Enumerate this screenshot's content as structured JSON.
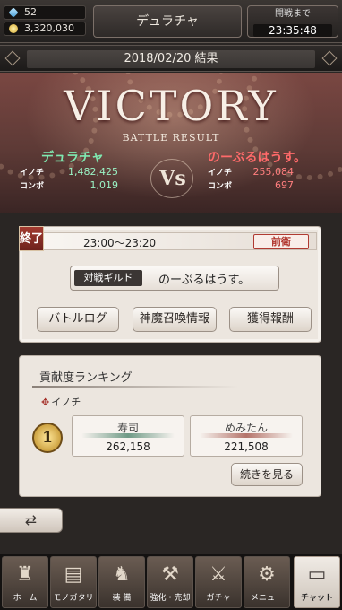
{
  "header": {
    "gems": "52",
    "coins": "3,320,030",
    "title": "デュラチャ",
    "timer_label": "開戦まで",
    "timer_value": "23:35:48"
  },
  "result_date": "2018/02/20 結果",
  "banner": {
    "victory": "VICTORY",
    "subtitle": "BATTLE RESULT",
    "vs": "Vs",
    "left_team": {
      "name": "デュラチャ",
      "inochi_label": "イノチ",
      "inochi": "1,482,425",
      "combo_label": "コンボ",
      "combo": "1,019"
    },
    "right_team": {
      "name": "のーぷるはうす。",
      "inochi_label": "イノチ",
      "inochi": "255,084",
      "combo_label": "コンボ",
      "combo": "697"
    }
  },
  "battle": {
    "status": "終了",
    "time_range": "23:00〜23:20",
    "position": "前衛",
    "opponent_label": "対戦ギルド",
    "opponent_name": "のーぷるはうす。",
    "buttons": [
      "バトルログ",
      "神魔召喚情報",
      "獲得報酬"
    ]
  },
  "ranking": {
    "title": "貢献度ランキング",
    "metric": "イノチ",
    "rank": "1",
    "entries": [
      {
        "name": "寿司",
        "score": "262,158",
        "color": "#6f9a86"
      },
      {
        "name": "めみたん",
        "score": "221,508",
        "color": "#b4746a"
      }
    ],
    "more_label": "続きを見る"
  },
  "nav": {
    "items": [
      {
        "label": "ホーム",
        "icon": "castle-icon"
      },
      {
        "label": "モノガタリ",
        "icon": "book-icon"
      },
      {
        "label": "装 備",
        "icon": "armor-icon"
      },
      {
        "label": "強化・売却",
        "icon": "enhance-icon"
      },
      {
        "label": "ガチャ",
        "icon": "crossed-swords-icon"
      },
      {
        "label": "メニュー",
        "icon": "gear-icon"
      },
      {
        "label": "チャット",
        "icon": "chat-bubble-icon"
      }
    ]
  },
  "colors": {
    "ally": "#7fe8b0",
    "enemy": "#ff6a6a",
    "accent_red": "#a23b30"
  }
}
